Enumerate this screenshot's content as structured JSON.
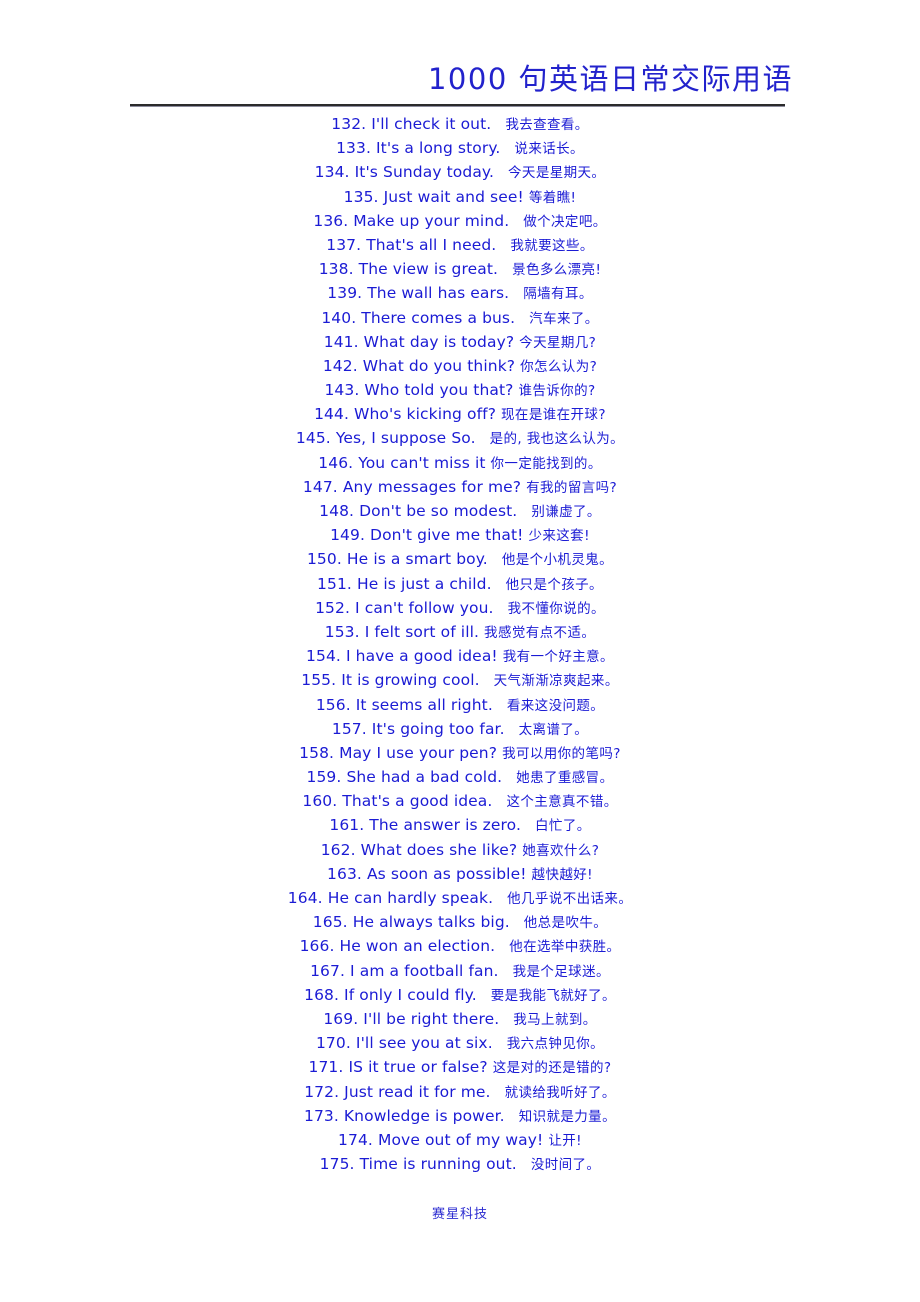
{
  "header": {
    "title": "1000 句英语日常交际用语",
    "rule_color": "#2b2b2b"
  },
  "colors": {
    "text_blue": "#1b1bd4",
    "title_blue": "#2222cc",
    "footer_blue": "#2a2ad0",
    "page_background": "#ffffff"
  },
  "footer": {
    "text": "赛星科技"
  },
  "lines": [
    {
      "num": "132.",
      "en": "I'll check it out.",
      "zh": "我去查查看。",
      "gap": "wide"
    },
    {
      "num": "133.",
      "en": "It's a long story.",
      "zh": "说来话长。",
      "gap": "wide"
    },
    {
      "num": "134.",
      "en": "It's Sunday today.",
      "zh": "今天是星期天。",
      "gap": "wide"
    },
    {
      "num": "135.",
      "en": "Just wait and see!",
      "zh": "等着瞧!",
      "gap": "narrow"
    },
    {
      "num": "136.",
      "en": "Make up your mind.",
      "zh": "做个决定吧。",
      "gap": "wide"
    },
    {
      "num": "137.",
      "en": "That's all I need.",
      "zh": "我就要这些。",
      "gap": "wide"
    },
    {
      "num": "138.",
      "en": "The view is great.",
      "zh": "景色多么漂亮!",
      "gap": "wide"
    },
    {
      "num": "139.",
      "en": "The wall has ears.",
      "zh": "隔墙有耳。",
      "gap": "wide"
    },
    {
      "num": "140.",
      "en": "There comes a bus.",
      "zh": "汽车来了。",
      "gap": "wide"
    },
    {
      "num": "141.",
      "en": "What day is today?",
      "zh": "今天星期几?",
      "gap": "narrow"
    },
    {
      "num": "142.",
      "en": "What do you think?",
      "zh": "你怎么认为?",
      "gap": "narrow"
    },
    {
      "num": "143.",
      "en": "Who told you that?",
      "zh": "谁告诉你的?",
      "gap": "narrow"
    },
    {
      "num": "144.",
      "en": "Who's kicking off?",
      "zh": "现在是谁在开球?",
      "gap": "narrow"
    },
    {
      "num": "145.",
      "en": "Yes,  I suppose So.",
      "zh": "是的, 我也这么认为。",
      "gap": "wide"
    },
    {
      "num": "146.",
      "en": "You can't miss it",
      "zh": "你一定能找到的。",
      "gap": "narrow"
    },
    {
      "num": "147.",
      "en": "Any messages for me?",
      "zh": "有我的留言吗?",
      "gap": "narrow"
    },
    {
      "num": "148.",
      "en": "Don't be so modest.",
      "zh": "别谦虚了。",
      "gap": "wide"
    },
    {
      "num": "149.",
      "en": "Don't give me that!",
      "zh": "少来这套!",
      "gap": "narrow"
    },
    {
      "num": "150.",
      "en": "He is a smart boy.",
      "zh": "他是个小机灵鬼。",
      "gap": "wide"
    },
    {
      "num": "151.",
      "en": "He is just a child.",
      "zh": "他只是个孩子。",
      "gap": "wide"
    },
    {
      "num": "152.",
      "en": "I can't follow you.",
      "zh": "我不懂你说的。",
      "gap": "wide"
    },
    {
      "num": "153.",
      "en": "I felt sort of ill.",
      "zh": "我感觉有点不适。",
      "gap": "narrow"
    },
    {
      "num": "154.",
      "en": "I have a good idea!",
      "zh": "我有一个好主意。",
      "gap": "narrow"
    },
    {
      "num": "155.",
      "en": "It is growing cool.",
      "zh": "天气渐渐凉爽起来。",
      "gap": "wide"
    },
    {
      "num": "156.",
      "en": "It seems all right.",
      "zh": "看来这没问题。",
      "gap": "wide"
    },
    {
      "num": "157.",
      "en": "It's going too far.",
      "zh": "太离谱了。",
      "gap": "wide"
    },
    {
      "num": "158.",
      "en": "May I use your pen?",
      "zh": "我可以用你的笔吗?",
      "gap": "narrow"
    },
    {
      "num": "159.",
      "en": "She had a bad cold.",
      "zh": "她患了重感冒。",
      "gap": "wide"
    },
    {
      "num": "160.",
      "en": "That's a good idea.",
      "zh": "这个主意真不错。",
      "gap": "wide"
    },
    {
      "num": "161.",
      "en": "The answer is zero.",
      "zh": "白忙了。",
      "gap": "wide"
    },
    {
      "num": "162.",
      "en": "What does she like?",
      "zh": "她喜欢什么?",
      "gap": "narrow"
    },
    {
      "num": "163.",
      "en": "As soon as possible!",
      "zh": "越快越好!",
      "gap": "narrow"
    },
    {
      "num": "164.",
      "en": "He can hardly speak.",
      "zh": "他几乎说不出话来。",
      "gap": "wide"
    },
    {
      "num": "165.",
      "en": "He always talks big.",
      "zh": "他总是吹牛。",
      "gap": "wide"
    },
    {
      "num": "166.",
      "en": "He won an election.",
      "zh": "他在选举中获胜。",
      "gap": "wide"
    },
    {
      "num": "167.",
      "en": "I am a football fan.",
      "zh": "我是个足球迷。",
      "gap": "wide"
    },
    {
      "num": "168.",
      "en": "If only I could fly.",
      "zh": "要是我能飞就好了。",
      "gap": "wide"
    },
    {
      "num": "169.",
      "en": "I'll be right there.",
      "zh": "我马上就到。",
      "gap": "wide"
    },
    {
      "num": "170.",
      "en": "I'll see you at six.",
      "zh": "我六点钟见你。",
      "gap": "wide"
    },
    {
      "num": "171.",
      "en": "IS it true or false?",
      "zh": "这是对的还是错的?",
      "gap": "narrow"
    },
    {
      "num": "172.",
      "en": "Just read it for me.",
      "zh": "就读给我听好了。",
      "gap": "wide"
    },
    {
      "num": "173.",
      "en": "Knowledge is power.",
      "zh": "知识就是力量。",
      "gap": "wide"
    },
    {
      "num": "174.",
      "en": "Move out of my way!",
      "zh": "让开!",
      "gap": "narrow"
    },
    {
      "num": "175.",
      "en": "Time is running out.",
      "zh": "没时间了。",
      "gap": "wide"
    }
  ]
}
